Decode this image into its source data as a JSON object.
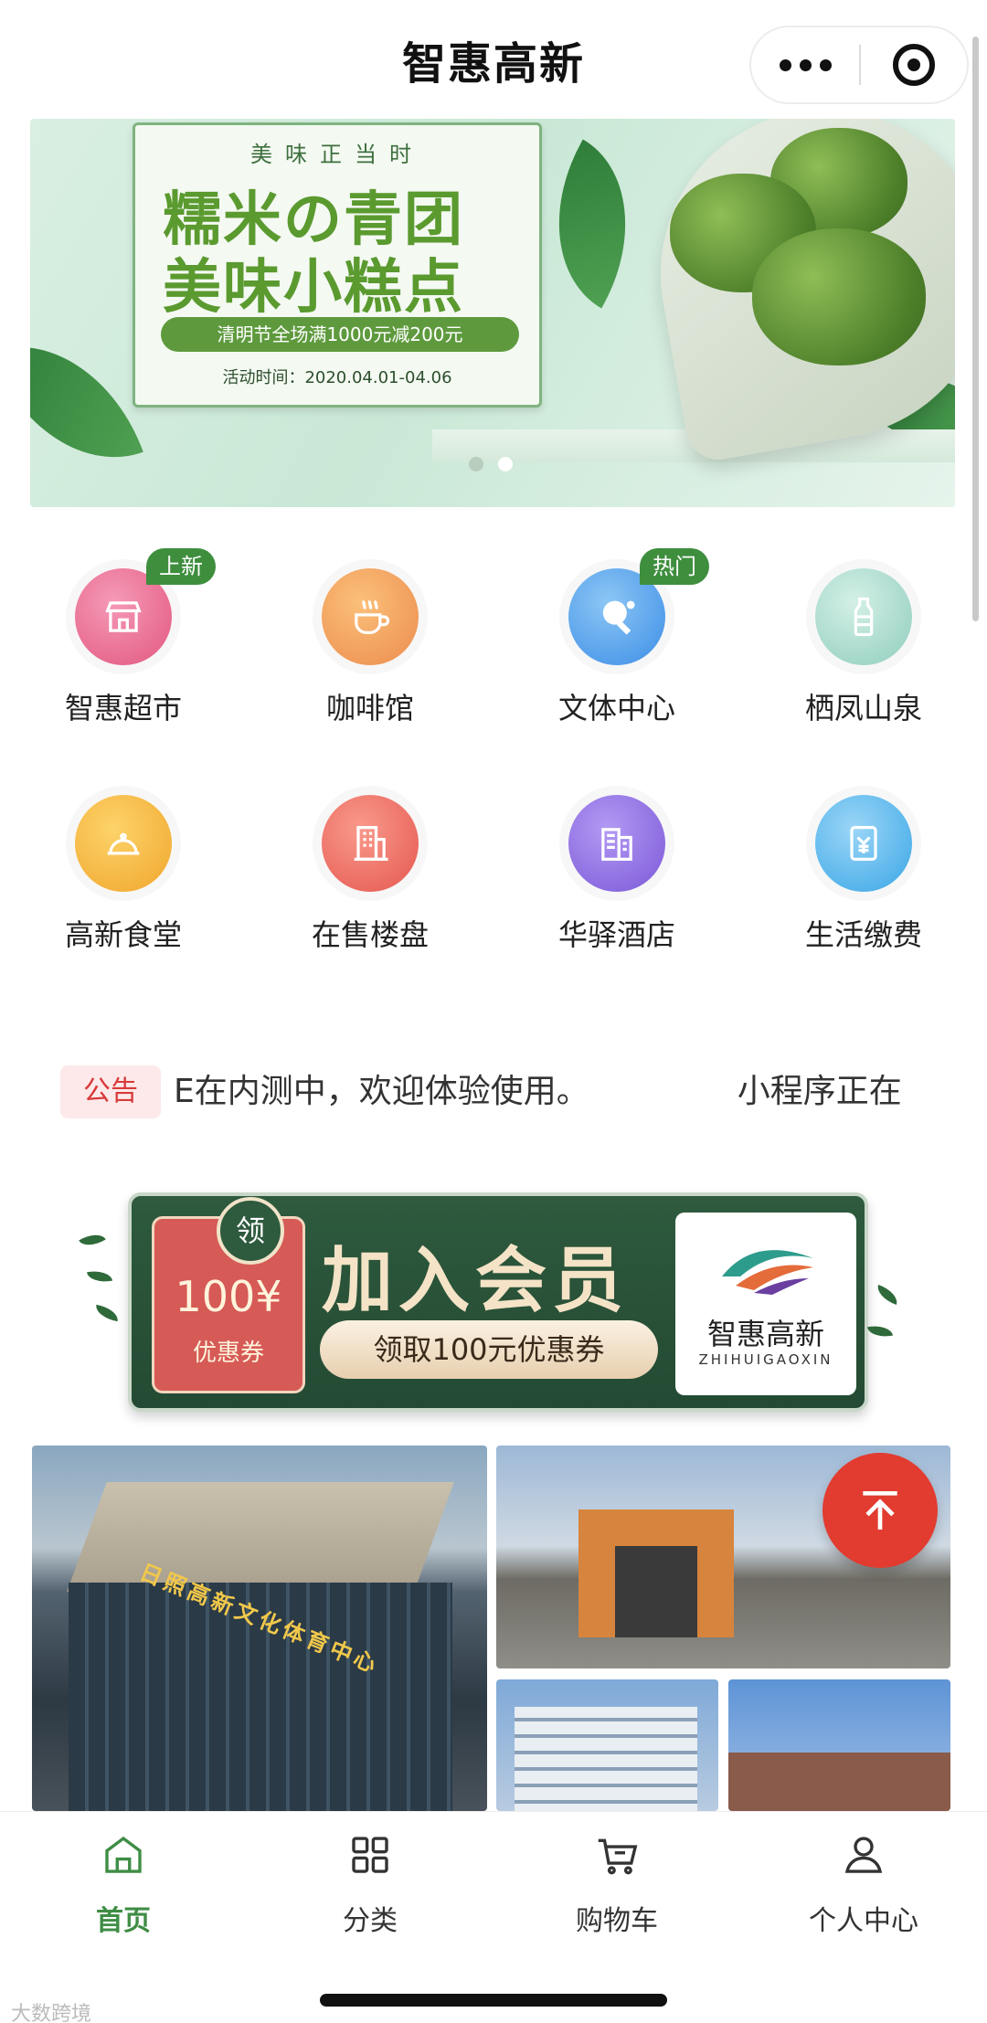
{
  "header": {
    "title": "智惠高新",
    "more_icon": "more-dots-icon",
    "close_icon": "target-close-icon"
  },
  "banner": {
    "tagline": "美味正当时",
    "headline_1": "糯米の青团",
    "headline_2": "美味小糕点",
    "promo": "清明节全场满1000元减200元",
    "dates": "活动时间：2020.04.01-04.06",
    "slide_count": 2,
    "active_slide": 2
  },
  "grid": {
    "items": [
      {
        "label": "智惠超市",
        "icon": "store-icon",
        "tag": "上新",
        "color": "#ea6a8e"
      },
      {
        "label": "咖啡馆",
        "icon": "coffee-cup-icon",
        "tag": "",
        "color": "#f1a15b"
      },
      {
        "label": "文体中心",
        "icon": "ping-pong-icon",
        "tag": "热门",
        "color": "#4a9bea"
      },
      {
        "label": "栖凤山泉",
        "icon": "water-bottle-icon",
        "tag": "",
        "color": "#9fd3c6"
      },
      {
        "label": "高新食堂",
        "icon": "food-cloche-icon",
        "tag": "",
        "color": "#f2b640"
      },
      {
        "label": "在售楼盘",
        "icon": "building-icon",
        "tag": "",
        "color": "#ee6a6a"
      },
      {
        "label": "华驿酒店",
        "icon": "hotel-icon",
        "tag": "",
        "color": "#8f6de0"
      },
      {
        "label": "生活缴费",
        "icon": "bill-payment-icon",
        "tag": "",
        "color": "#58b6e9"
      }
    ]
  },
  "notice": {
    "badge": "公告",
    "text": "E在内测中，欢迎体验使用。　　　　　小程序正在"
  },
  "member": {
    "ling": "领",
    "coupon_amount": "100¥",
    "coupon_desc": "优惠券",
    "title": "加入会员",
    "button": "领取100元优惠券",
    "logo_name": "智惠高新",
    "logo_en": "ZHIHUIGAOXIN"
  },
  "photos": {
    "p1_label": "日照高新文化体育中心"
  },
  "tabbar": {
    "tabs": [
      {
        "label": "首页",
        "icon": "home-icon",
        "active": true
      },
      {
        "label": "分类",
        "icon": "grid-category-icon",
        "active": false
      },
      {
        "label": "购物车",
        "icon": "cart-icon",
        "active": false
      },
      {
        "label": "个人中心",
        "icon": "user-icon",
        "active": false
      }
    ]
  },
  "watermark": "大数跨境",
  "colors": {
    "accent_green": "#3f8d45",
    "notice_red": "#d83a3a",
    "top_button_red": "#e23b2f",
    "member_green": "#2e5a3e"
  }
}
